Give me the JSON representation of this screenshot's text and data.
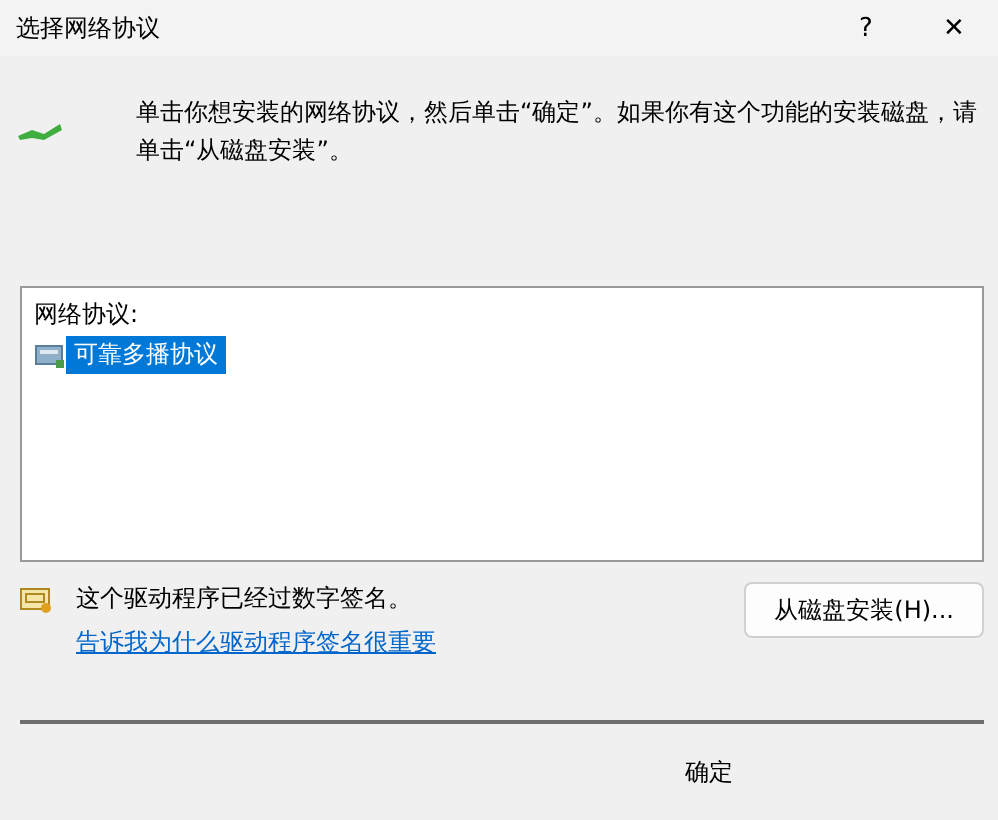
{
  "window": {
    "title": "选择网络协议",
    "help": "?",
    "close": "✕"
  },
  "instruction": "单击你想安装的网络协议，然后单击“确定”。如果你有这个功能的安装磁盘，请单击“从磁盘安装”。",
  "list": {
    "label": "网络协议:",
    "items": [
      {
        "label": "可靠多播协议",
        "selected": true
      }
    ]
  },
  "signature": {
    "text": "这个驱动程序已经过数字签名。",
    "link": "告诉我为什么驱动程序签名很重要"
  },
  "buttons": {
    "have_disk": "从磁盘安装(H)...",
    "ok": "确定"
  }
}
